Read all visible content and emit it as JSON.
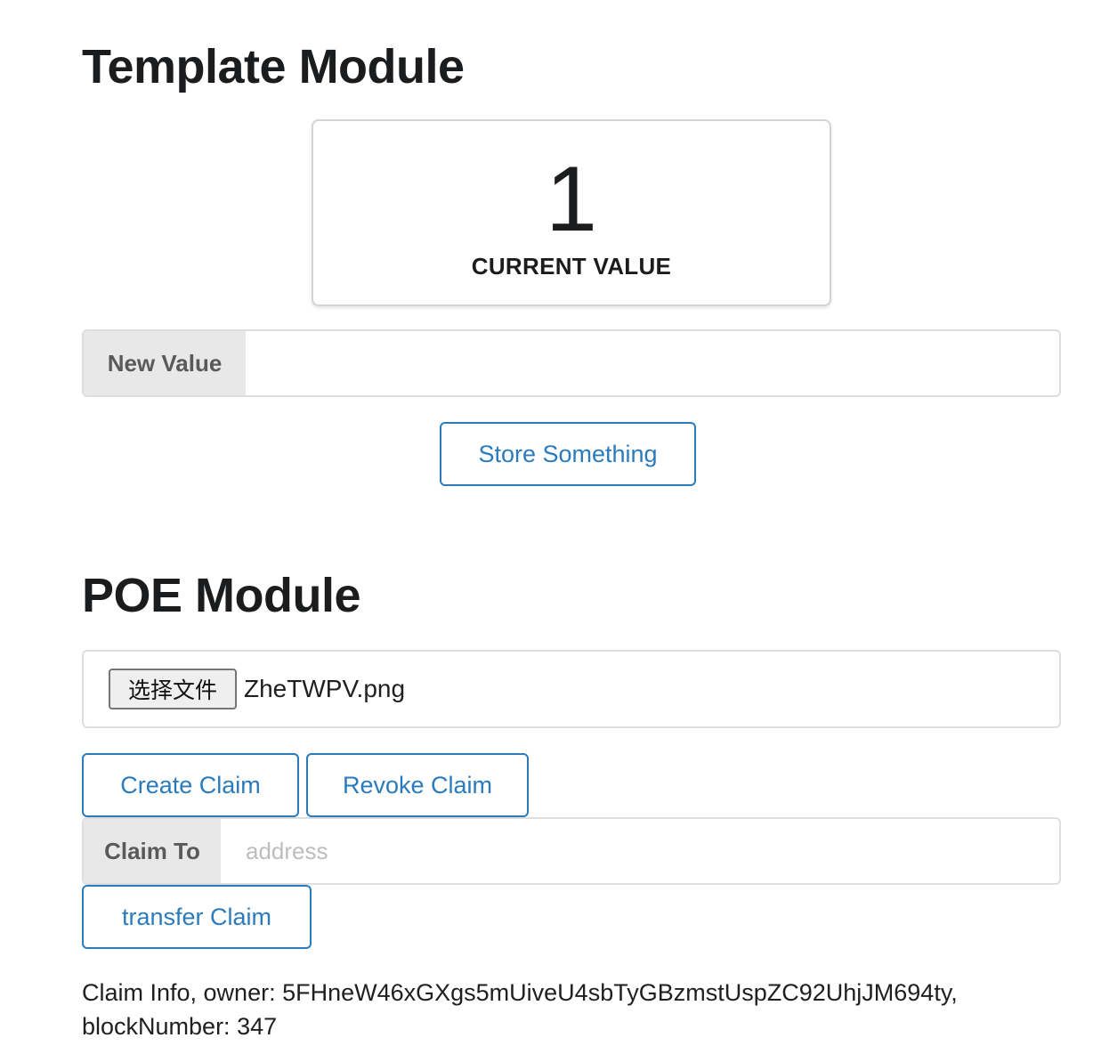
{
  "template_module": {
    "title": "Template Module",
    "current_value": "1",
    "current_value_label": "CURRENT VALUE",
    "new_value_label": "New Value",
    "new_value_input": "",
    "store_button": "Store Something"
  },
  "poe_module": {
    "title": "POE Module",
    "file_button": "选择文件",
    "file_name": "ZheTWPV.png",
    "create_button": "Create Claim",
    "revoke_button": "Revoke Claim",
    "claim_to_label": "Claim To",
    "claim_to_placeholder": "address",
    "transfer_button": "transfer Claim",
    "claim_info_line1": "Claim Info, owner: 5FHneW46xGXgs5mUiveU4sbTyGBzmstUspZC92UhjJM694ty,",
    "claim_info_line2": "blockNumber: 347"
  },
  "colors": {
    "accent": "#2a7bbd",
    "label_bg": "#e8e8e8"
  }
}
